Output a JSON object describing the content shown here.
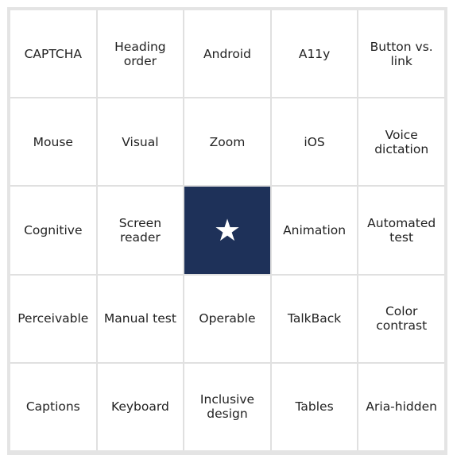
{
  "board": {
    "free_icon": "star-icon",
    "free_color": "#1e3159",
    "cells": [
      "CAPTCHA",
      "Heading order",
      "Android",
      "A11y",
      "Button vs. link",
      "Mouse",
      "Visual",
      "Zoom",
      "iOS",
      "Voice dictation",
      "Cognitive",
      "Screen reader",
      "",
      "Animation",
      "Automated test",
      "Perceivable",
      "Manual test",
      "Operable",
      "TalkBack",
      "Color contrast",
      "Captions",
      "Keyboard",
      "Inclusive design",
      "Tables",
      "Aria-hidden"
    ]
  }
}
